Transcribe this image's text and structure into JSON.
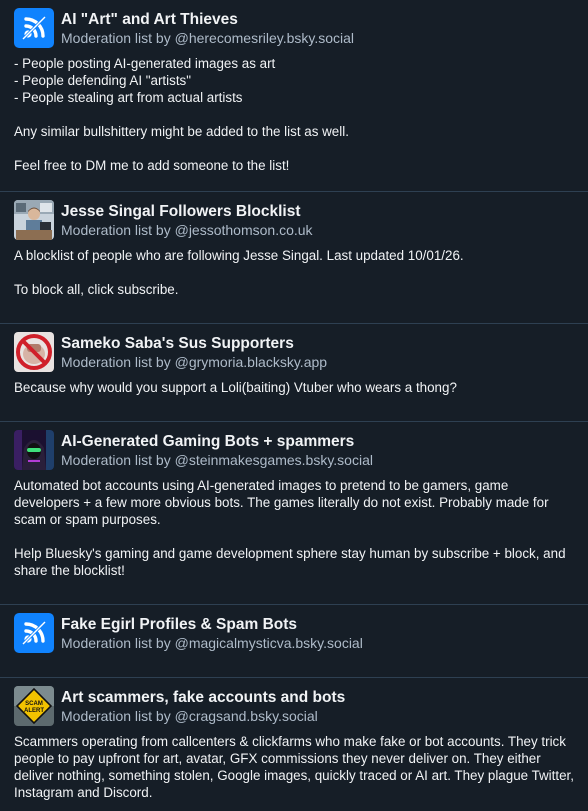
{
  "lists": [
    {
      "title": "AI \"Art\" and Art Thieves",
      "byline": "Moderation list by @herecomesriley.bsky.social",
      "avatar_icon": "default-list-icon",
      "description": "- People posting AI-generated images as art\n- People defending AI \"artists\"\n- People stealing art from actual artists\n\nAny similar bullshittery might be added to the list as well.\n\nFeel free to DM me to add someone to the list!"
    },
    {
      "title": "Jesse Singal Followers Blocklist",
      "byline": "Moderation list by @jessothomson.co.uk",
      "avatar_icon": "person-at-desk-image",
      "description": "A blocklist of people who are following Jesse Singal. Last updated 10/01/26.\n\nTo block all, click subscribe."
    },
    {
      "title": "Sameko Saba's Sus Supporters",
      "byline": "Moderation list by @grymoria.blacksky.app",
      "avatar_icon": "no-symbol-image",
      "description": "Because why would you support a Loli(baiting) Vtuber who wears a thong?"
    },
    {
      "title": "AI-Generated Gaming Bots + spammers",
      "byline": "Moderation list by @steinmakesgames.bsky.social",
      "avatar_icon": "hooded-figure-image",
      "description": "Automated bot accounts using AI-generated images to pretend to be gamers, game developers + a few more obvious bots. The games literally do not exist. Probably made for scam or spam purposes.\n\nHelp Bluesky's gaming and game development sphere stay human by subscribe + block, and share the blocklist!"
    },
    {
      "title": "Fake Egirl Profiles & Spam Bots",
      "byline": "Moderation list by @magicalmysticva.bsky.social",
      "avatar_icon": "default-list-icon",
      "description": ""
    },
    {
      "title": "Art scammers, fake accounts and bots",
      "byline": "Moderation list by @cragsand.bsky.social",
      "avatar_icon": "scam-alert-sign-image",
      "avatar_text": "SCAM ALERT",
      "description": "Scammers operating from callcenters & clickfarms who make fake or bot accounts. They trick people to pay upfront for art, avatar, GFX commissions they never deliver on. They either deliver nothing, something stolen, Google images, quickly traced or AI art. They plague Twitter, Instagram and Discord."
    }
  ],
  "colors": {
    "background": "#161e27",
    "divider": "#2e4052",
    "accent": "#1083fe",
    "secondary_text": "#aebbc9"
  }
}
